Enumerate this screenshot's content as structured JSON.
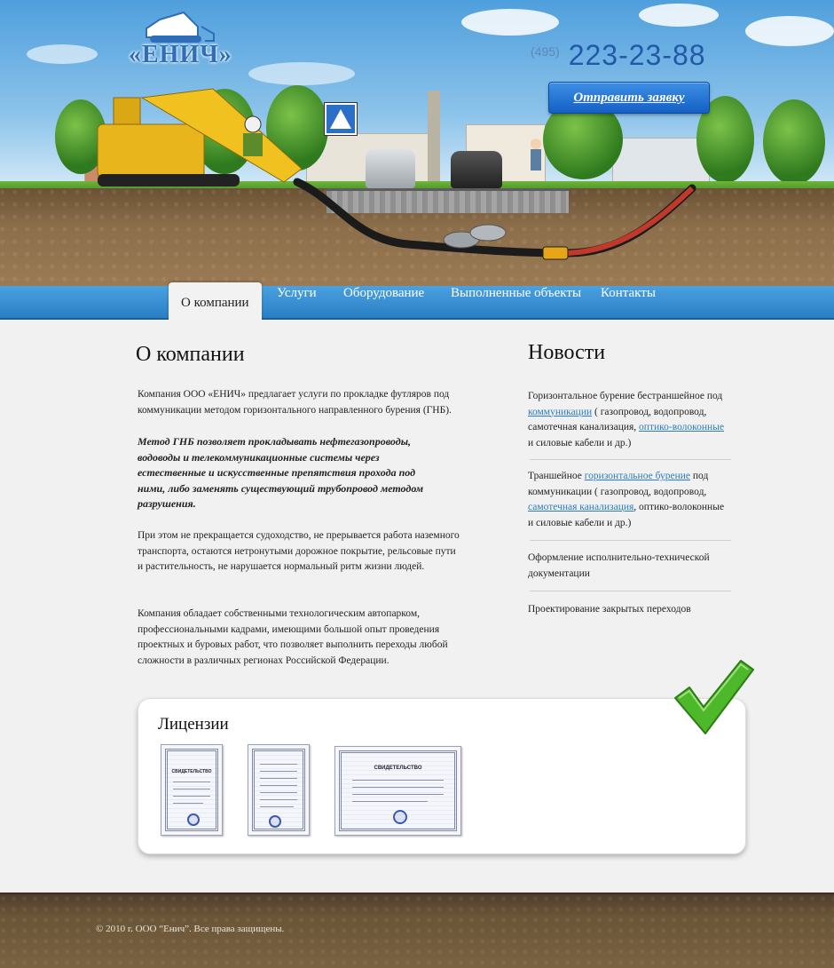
{
  "header": {
    "logo_text": "«ЕНИЧ»",
    "phone_code": "(495)",
    "phone_number": "223-23-88",
    "cta_label": "Отправить заявку"
  },
  "nav": {
    "items": [
      {
        "label": "О компании",
        "active": true
      },
      {
        "label": "Услуги",
        "active": false
      },
      {
        "label": "Оборудование",
        "active": false
      },
      {
        "label": "Выполненные объекты",
        "active": false
      },
      {
        "label": "Контакты",
        "active": false
      }
    ]
  },
  "main": {
    "title": "О компании",
    "paragraphs": [
      "Компания ООО «ЕНИЧ» предлагает услуги по прокладке футляров под коммуникации методом горизонтального направленного бурения (ГНБ).",
      "Метод ГНБ позволяет прокладывать нефтегазопроводы, водоводы и телекоммуникационные системы через естественные и искусственные препятствия прохода под ними, либо заменять существующий трубопровод методом разрушения.",
      "При этом не прекращается судоходство, не прерывается работа наземного транспорта, остаются нетронутыми дорожное покрытие, рельсовые пути и растительность, не нарушается нормальный ритм жизни людей.",
      "Компания обладает собственными технологическим автопарком, профессиональными кадрами, имеющими большой опыт проведения проектных и буровых работ, что позволяет выполнить переходы любой сложности в различных регионах Российской Федерации."
    ]
  },
  "news": {
    "title": "Новости",
    "items": [
      {
        "before": "Горизонтальное бурение бестраншейное под ",
        "link1": "коммуникации",
        "middle": " ( газопровод, водопровод, самотечная канализация, ",
        "link2": "оптико-волоконные",
        "after": " и силовые кабели и др.)"
      },
      {
        "before": "Траншейное ",
        "link1": "горизонтальное бурение",
        "middle": " под коммуникации ( газопровод, водопровод, ",
        "link2": "самотечная канализация",
        "after": ", оптико-волоконные и силовые кабели и др.)"
      },
      {
        "text": "Оформление исполнительно-технической документации"
      },
      {
        "text": "Проектирование закрытых переходов"
      }
    ]
  },
  "licenses": {
    "title": "Лицензии",
    "doc_heading": "СВИДЕТЕЛЬСТВО"
  },
  "footer": {
    "copyright": "© 2010 г. ООО “Енич”. Все права защищены."
  },
  "colors": {
    "nav_blue": "#2a7fc4",
    "link_blue": "#2a7bc1",
    "cta_blue": "#1a66cc",
    "check_green": "#4cb82a"
  }
}
